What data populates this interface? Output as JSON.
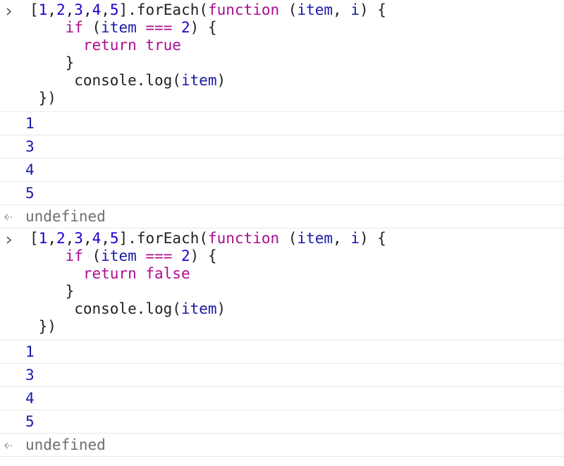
{
  "blocks": [
    {
      "input_lines": [
        [
          {
            "t": "[",
            "c": "plain"
          },
          {
            "t": "1",
            "c": "num"
          },
          {
            "t": ",",
            "c": "plain"
          },
          {
            "t": "2",
            "c": "num"
          },
          {
            "t": ",",
            "c": "plain"
          },
          {
            "t": "3",
            "c": "num"
          },
          {
            "t": ",",
            "c": "plain"
          },
          {
            "t": "4",
            "c": "num"
          },
          {
            "t": ",",
            "c": "plain"
          },
          {
            "t": "5",
            "c": "num"
          },
          {
            "t": "].forEach(",
            "c": "plain"
          },
          {
            "t": "function",
            "c": "kw"
          },
          {
            "t": " (",
            "c": "plain"
          },
          {
            "t": "item",
            "c": "var"
          },
          {
            "t": ", ",
            "c": "plain"
          },
          {
            "t": "i",
            "c": "var"
          },
          {
            "t": ") {",
            "c": "plain"
          }
        ],
        [
          {
            "t": "    ",
            "c": "plain"
          },
          {
            "t": "if",
            "c": "kw"
          },
          {
            "t": " (",
            "c": "plain"
          },
          {
            "t": "item",
            "c": "var"
          },
          {
            "t": " ",
            "c": "plain"
          },
          {
            "t": "===",
            "c": "kw"
          },
          {
            "t": " ",
            "c": "plain"
          },
          {
            "t": "2",
            "c": "num"
          },
          {
            "t": ") {",
            "c": "plain"
          }
        ],
        [
          {
            "t": "      ",
            "c": "plain"
          },
          {
            "t": "return",
            "c": "kw"
          },
          {
            "t": " ",
            "c": "plain"
          },
          {
            "t": "true",
            "c": "kw"
          }
        ],
        [
          {
            "t": "    }",
            "c": "plain"
          }
        ],
        [
          {
            "t": "     console.log(",
            "c": "plain"
          },
          {
            "t": "item",
            "c": "var"
          },
          {
            "t": ")",
            "c": "plain"
          }
        ],
        [
          {
            "t": " })",
            "c": "plain"
          }
        ]
      ],
      "logs": [
        "1",
        "3",
        "4",
        "5"
      ],
      "result": "undefined"
    },
    {
      "input_lines": [
        [
          {
            "t": "[",
            "c": "plain"
          },
          {
            "t": "1",
            "c": "num"
          },
          {
            "t": ",",
            "c": "plain"
          },
          {
            "t": "2",
            "c": "num"
          },
          {
            "t": ",",
            "c": "plain"
          },
          {
            "t": "3",
            "c": "num"
          },
          {
            "t": ",",
            "c": "plain"
          },
          {
            "t": "4",
            "c": "num"
          },
          {
            "t": ",",
            "c": "plain"
          },
          {
            "t": "5",
            "c": "num"
          },
          {
            "t": "].forEach(",
            "c": "plain"
          },
          {
            "t": "function",
            "c": "kw"
          },
          {
            "t": " (",
            "c": "plain"
          },
          {
            "t": "item",
            "c": "var"
          },
          {
            "t": ", ",
            "c": "plain"
          },
          {
            "t": "i",
            "c": "var"
          },
          {
            "t": ") {",
            "c": "plain"
          }
        ],
        [
          {
            "t": "    ",
            "c": "plain"
          },
          {
            "t": "if",
            "c": "kw"
          },
          {
            "t": " (",
            "c": "plain"
          },
          {
            "t": "item",
            "c": "var"
          },
          {
            "t": " ",
            "c": "plain"
          },
          {
            "t": "===",
            "c": "kw"
          },
          {
            "t": " ",
            "c": "plain"
          },
          {
            "t": "2",
            "c": "num"
          },
          {
            "t": ") {",
            "c": "plain"
          }
        ],
        [
          {
            "t": "      ",
            "c": "plain"
          },
          {
            "t": "return",
            "c": "kw"
          },
          {
            "t": " ",
            "c": "plain"
          },
          {
            "t": "false",
            "c": "kw"
          }
        ],
        [
          {
            "t": "    }",
            "c": "plain"
          }
        ],
        [
          {
            "t": "     console.log(",
            "c": "plain"
          },
          {
            "t": "item",
            "c": "var"
          },
          {
            "t": ")",
            "c": "plain"
          }
        ],
        [
          {
            "t": " })",
            "c": "plain"
          }
        ]
      ],
      "logs": [
        "1",
        "3",
        "4",
        "5"
      ],
      "result": "undefined"
    }
  ],
  "icons": {
    "input_prompt": "chevron-right-icon",
    "result_prompt": "result-arrow-icon"
  },
  "colors": {
    "number": "#1c00cf",
    "keyword": "#aa0d91",
    "log_value": "#1a1aa6",
    "result_text": "#6e6e6e",
    "separator": "#e8e8e8"
  }
}
